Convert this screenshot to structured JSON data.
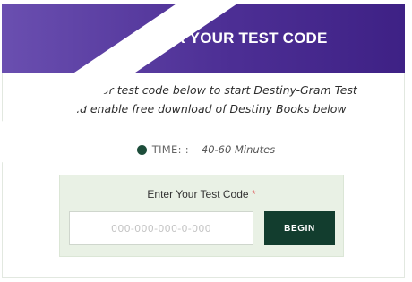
{
  "header": {
    "title": "ENTER YOUR TEST CODE"
  },
  "intro": {
    "line1": "Enter your test code below to start Destiny-Gram Test",
    "line2": "and enable free download of Destiny Books below"
  },
  "time": {
    "icon": "clock-icon",
    "label": "TIME: :",
    "value": "40-60 Minutes"
  },
  "code_form": {
    "label": "Enter Your Test Code",
    "required_marker": "*",
    "input_placeholder": "000-000-000-0-000",
    "input_value": "",
    "begin_label": "BEGIN"
  },
  "colors": {
    "header_gradient_start": "#6a4fb0",
    "header_gradient_end": "#3e2185",
    "button": "#123d2e",
    "code_box_bg": "#e9f1e5",
    "required": "#e06060"
  }
}
